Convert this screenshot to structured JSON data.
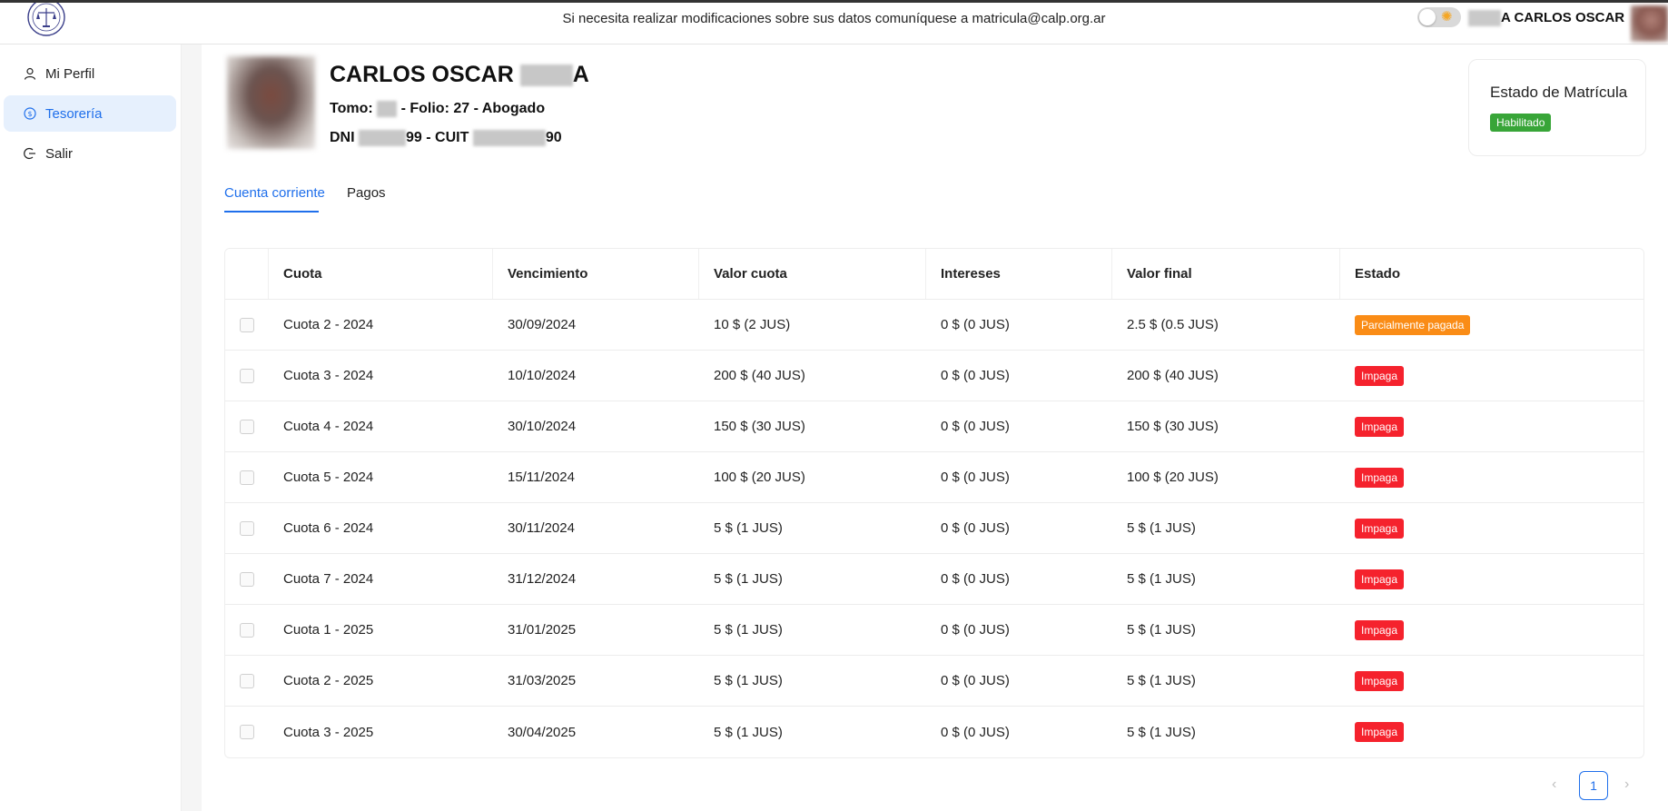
{
  "header": {
    "notice": "Si necesita realizar modificaciones sobre sus datos comuníquese a matricula@calp.org.ar",
    "username": "A CARLOS OSCAR"
  },
  "sidebar": {
    "items": [
      {
        "label": "Mi Perfil",
        "icon": "user-icon",
        "active": false
      },
      {
        "label": "Tesorería",
        "icon": "dollar-circle-icon",
        "active": true
      },
      {
        "label": "Salir",
        "icon": "logout-icon",
        "active": false
      }
    ]
  },
  "profile": {
    "name": "CARLOS OSCAR",
    "name_suffix": "A",
    "tomo_label": "Tomo:",
    "folio_text": "- Folio: 27 - Abogado",
    "dni_label": "DNI",
    "dni_suffix": "99 - CUIT",
    "cuit_suffix": "90"
  },
  "status_card": {
    "title": "Estado de Matrícula",
    "status": "Habilitado",
    "status_color": "#38a538"
  },
  "tabs": [
    {
      "label": "Cuenta corriente",
      "active": true
    },
    {
      "label": "Pagos",
      "active": false
    }
  ],
  "table": {
    "headers": [
      "Cuota",
      "Vencimiento",
      "Valor cuota",
      "Intereses",
      "Valor final",
      "Estado"
    ],
    "rows": [
      {
        "cuota": "Cuota 2 - 2024",
        "vencimiento": "30/09/2024",
        "valor": "10 $ (2 JUS)",
        "intereses": "0 $ (0 JUS)",
        "final": "2.5 $ (0.5 JUS)",
        "estado": "Parcialmente pagada",
        "estado_color": "#fa8c16"
      },
      {
        "cuota": "Cuota 3 - 2024",
        "vencimiento": "10/10/2024",
        "valor": "200 $ (40 JUS)",
        "intereses": "0 $ (0 JUS)",
        "final": "200 $ (40 JUS)",
        "estado": "Impaga",
        "estado_color": "#f5222d"
      },
      {
        "cuota": "Cuota 4 - 2024",
        "vencimiento": "30/10/2024",
        "valor": "150 $ (30 JUS)",
        "intereses": "0 $ (0 JUS)",
        "final": "150 $ (30 JUS)",
        "estado": "Impaga",
        "estado_color": "#f5222d"
      },
      {
        "cuota": "Cuota 5 - 2024",
        "vencimiento": "15/11/2024",
        "valor": "100 $ (20 JUS)",
        "intereses": "0 $ (0 JUS)",
        "final": "100 $ (20 JUS)",
        "estado": "Impaga",
        "estado_color": "#f5222d"
      },
      {
        "cuota": "Cuota 6 - 2024",
        "vencimiento": "30/11/2024",
        "valor": "5 $ (1 JUS)",
        "intereses": "0 $ (0 JUS)",
        "final": "5 $ (1 JUS)",
        "estado": "Impaga",
        "estado_color": "#f5222d"
      },
      {
        "cuota": "Cuota 7 - 2024",
        "vencimiento": "31/12/2024",
        "valor": "5 $ (1 JUS)",
        "intereses": "0 $ (0 JUS)",
        "final": "5 $ (1 JUS)",
        "estado": "Impaga",
        "estado_color": "#f5222d"
      },
      {
        "cuota": "Cuota 1 - 2025",
        "vencimiento": "31/01/2025",
        "valor": "5 $ (1 JUS)",
        "intereses": "0 $ (0 JUS)",
        "final": "5 $ (1 JUS)",
        "estado": "Impaga",
        "estado_color": "#f5222d"
      },
      {
        "cuota": "Cuota 2 - 2025",
        "vencimiento": "31/03/2025",
        "valor": "5 $ (1 JUS)",
        "intereses": "0 $ (0 JUS)",
        "final": "5 $ (1 JUS)",
        "estado": "Impaga",
        "estado_color": "#f5222d"
      },
      {
        "cuota": "Cuota 3 - 2025",
        "vencimiento": "30/04/2025",
        "valor": "5 $ (1 JUS)",
        "intereses": "0 $ (0 JUS)",
        "final": "5 $ (1 JUS)",
        "estado": "Impaga",
        "estado_color": "#f5222d"
      }
    ]
  },
  "pagination": {
    "prev": "‹",
    "current": "1",
    "next": "›"
  },
  "colors": {
    "accent": "#1f6feb",
    "active_bg": "#e6f0fd"
  }
}
